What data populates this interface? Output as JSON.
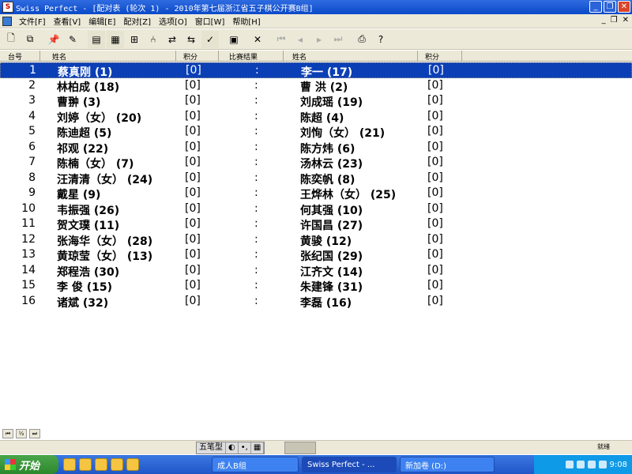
{
  "window": {
    "title": "Swiss Perfect - [配对表 (轮次 1) - 2010年第七届浙江省五子棋公开赛B组]",
    "app_icon_letter": "S",
    "minimize": "_",
    "maximize": "❐",
    "close": "✕"
  },
  "menu": [
    "文件[F]",
    "查看[V]",
    "编辑[E]",
    "配对[Z]",
    "选项[O]",
    "窗口[W]",
    "帮助[H]"
  ],
  "mdi_controls": [
    "_",
    "❐",
    "✕"
  ],
  "toolbar": {
    "icons": [
      "new-icon",
      "copy-icon",
      "pin-icon",
      "pin-check-icon",
      "notebook-icon",
      "table-icon",
      "grid-icon",
      "fork-icon",
      "pairing-icon",
      "pairing-alt-icon",
      "check-icon",
      "print-preview-icon",
      "delete-icon",
      "first-icon",
      "prev-icon",
      "next-icon",
      "last-icon",
      "printer-icon",
      "help-icon"
    ]
  },
  "columns": {
    "board": "台号",
    "name1": "姓名",
    "points1": "积分",
    "result": "比赛结果",
    "name2": "姓名",
    "points2": "积分"
  },
  "pairings": [
    {
      "board": "1",
      "white": "蔡真刚 (1)",
      "wpts": "[0]",
      "result": ":",
      "black": "李一 (17)",
      "bpts": "[0]"
    },
    {
      "board": "2",
      "white": "林柏成 (18)",
      "wpts": "[0]",
      "result": ":",
      "black": "曹 洪 (2)",
      "bpts": "[0]"
    },
    {
      "board": "3",
      "white": "曹翀 (3)",
      "wpts": "[0]",
      "result": ":",
      "black": "刘成瑶 (19)",
      "bpts": "[0]"
    },
    {
      "board": "4",
      "white": "刘婷（女） (20)",
      "wpts": "[0]",
      "result": ":",
      "black": "陈超 (4)",
      "bpts": "[0]"
    },
    {
      "board": "5",
      "white": "陈迪超 (5)",
      "wpts": "[0]",
      "result": ":",
      "black": "刘恂（女） (21)",
      "bpts": "[0]"
    },
    {
      "board": "6",
      "white": "祁观 (22)",
      "wpts": "[0]",
      "result": ":",
      "black": "陈方炜 (6)",
      "bpts": "[0]"
    },
    {
      "board": "7",
      "white": "陈楠（女） (7)",
      "wpts": "[0]",
      "result": ":",
      "black": "汤林云 (23)",
      "bpts": "[0]"
    },
    {
      "board": "8",
      "white": "汪清清（女） (24)",
      "wpts": "[0]",
      "result": ":",
      "black": "陈奕帆 (8)",
      "bpts": "[0]"
    },
    {
      "board": "9",
      "white": "戴星 (9)",
      "wpts": "[0]",
      "result": ":",
      "black": "王烨林（女） (25)",
      "bpts": "[0]"
    },
    {
      "board": "10",
      "white": "韦振强 (26)",
      "wpts": "[0]",
      "result": ":",
      "black": "何其强 (10)",
      "bpts": "[0]"
    },
    {
      "board": "11",
      "white": "贺文璞 (11)",
      "wpts": "[0]",
      "result": ":",
      "black": "许国昌 (27)",
      "bpts": "[0]"
    },
    {
      "board": "12",
      "white": "张海华（女） (28)",
      "wpts": "[0]",
      "result": ":",
      "black": "黄骏 (12)",
      "bpts": "[0]"
    },
    {
      "board": "13",
      "white": "黄琼莹（女） (13)",
      "wpts": "[0]",
      "result": ":",
      "black": "张纪国 (29)",
      "bpts": "[0]"
    },
    {
      "board": "14",
      "white": "郑程浩 (30)",
      "wpts": "[0]",
      "result": ":",
      "black": "江齐文 (14)",
      "bpts": "[0]"
    },
    {
      "board": "15",
      "white": "李 俊 (15)",
      "wpts": "[0]",
      "result": ":",
      "black": "朱建锋 (31)",
      "bpts": "[0]"
    },
    {
      "board": "16",
      "white": "诸斌 (32)",
      "wpts": "[0]",
      "result": ":",
      "black": "李磊 (16)",
      "bpts": "[0]"
    }
  ],
  "selected_board": "1",
  "record_nav": [
    "⏮",
    "½",
    "⏭"
  ],
  "ime": [
    "五笔型",
    "◐",
    "•,",
    "▦"
  ],
  "status": {
    "label": "就绪"
  },
  "taskbar": {
    "start": "开始",
    "tasks": [
      "成人B组",
      "Swiss Perfect - ...",
      "新加卷 (D:)"
    ],
    "active_task": "Swiss Perfect - ...",
    "clock": "9:08"
  }
}
